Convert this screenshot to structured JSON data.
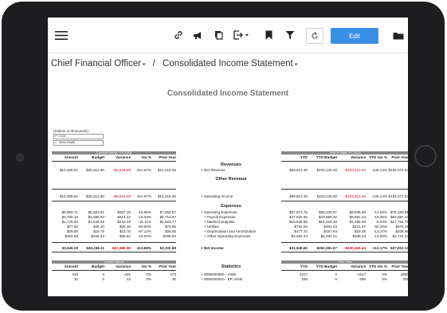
{
  "toolbar": {
    "edit_label": "Edit"
  },
  "breadcrumb": {
    "parent": "Chief Financial Officer",
    "separator": "/",
    "current": "Consolidated Income Statement"
  },
  "report": {
    "title": "Consolidated Income Statement"
  },
  "params": {
    "label": "(Dollars in thousands)",
    "fiscal_year": "FY 2018",
    "facility": "1 - Metro Health"
  },
  "left_header": "Current Period : FY 2018",
  "right_header": "Year to Date: FY 2018",
  "left_cols": [
    "Amount",
    "Budget",
    "Variance",
    "Var %",
    "Prior Year"
  ],
  "right_cols": [
    "YTD",
    "YTD Budget",
    "Variance",
    "YTD Var %",
    "Prior Year"
  ],
  "sections": {
    "revenues": "Revenues",
    "other_revenue": "Other Revenue",
    "expenses": "Expenses",
    "statistics": "Statistics"
  },
  "left_rows": [
    [
      "$10,495.91",
      "$20,312.50",
      "-$9,816.59",
      "-151.67%",
      "$10,215.46"
    ],
    [
      "$10,495.91",
      "$20,312.50",
      "-$9,816.59",
      "-151.67%",
      "$10,215.46"
    ],
    [
      "$6,850.71",
      "$5,923.61",
      "$927.10",
      "-15.65%",
      "$7,862.57"
    ],
    [
      "$4,700.16",
      "$4,085.94",
      "$614.22",
      "-15.03%",
      "$5,710.97"
    ],
    [
      "$1,778.82",
      "$1,545.35",
      "$233.48",
      "-15.11%",
      "$1,803.77"
    ],
    [
      "$77.20",
      "$48.10",
      "$29.10",
      "-60.50%",
      "$74.65"
    ],
    [
      "$29.55",
      "$15.79",
      "$13.76",
      "-87.12%",
      "$26.05"
    ],
    [
      "$264.96",
      "$228.42",
      "$36.54",
      "-16.00%",
      "$266.92"
    ],
    [
      "$3,645.20",
      "$26,236.11",
      "-$22,590.90",
      "-113.89%",
      "$2,332.89"
    ]
  ],
  "middle_labels": [
    "+ Net Revenue",
    "+ Operating Income",
    "+ Operating Expenses",
    "+ Payroll Expenses",
    "+ Medical Supplies",
    "+ Utilities",
    "+ Depreciation and Amortization",
    "+ Other Operating Expenses",
    "+ Net Income"
  ],
  "right_rows": [
    [
      "$99,812.38",
      "$203,125.00",
      "-$103,312.62",
      "-149.14%",
      "$104,072.94"
    ],
    [
      "$99,812.38",
      "$203,125.00",
      "-$103,312.62",
      "-149.14%",
      "$104,072.94"
    ],
    [
      "$67,871.76",
      "$59,236.07",
      "$8,635.69",
      "-14.58%",
      "$76,160.81"
    ],
    [
      "$47,540.65",
      "$40,859.42",
      "$6,681.23",
      "-16.35%",
      "$54,597.23"
    ],
    [
      "$16,848.86",
      "$15,453.48",
      "$1,395.39",
      "-9.03%",
      "$17,754.79"
    ],
    [
      "$722.50",
      "$481.03",
      "$241.47",
      "-50.20%",
      "$678.38"
    ],
    [
      "$177.31",
      "$157.93",
      "$19.38",
      "-12.27%",
      "$208.98"
    ],
    [
      "$2,582.44",
      "$2,294.21",
      "$288.23",
      "-13.06%",
      "$2,721.43"
    ],
    [
      "$31,940.62",
      "$262,361.07",
      "-$230,420.44",
      "-112.17%",
      "$27,912.13"
    ]
  ],
  "left_stat_header": "Current Month",
  "right_stat_header": "Prior Year",
  "left_stat_cols": [
    "Amount",
    "Budget",
    "Variance",
    "Var %",
    "Prior Year"
  ],
  "right_stat_cols": [
    "YTD",
    "YTD Budget",
    "Variance",
    "YTD Var %",
    "Prior Year"
  ],
  "stat_labels": [
    "+ 0090400000 - Visits",
    "+ 0090400010 - ER Visits"
  ],
  "left_stat_rows": [
    [
      "425",
      "0",
      "-425",
      "0%",
      "476"
    ],
    [
      "32",
      "0",
      "-32",
      "0%",
      "30"
    ]
  ],
  "right_stat_rows": [
    [
      "4317",
      "0",
      "-4317",
      "0%",
      "4680"
    ],
    [
      "256",
      "0",
      "-256",
      "0%",
      "258"
    ]
  ],
  "icons": [
    "menu-icon",
    "link-icon",
    "announce-icon",
    "copy-icon",
    "export-icon",
    "bookmark-icon",
    "filter-icon",
    "refresh-icon",
    "folder-icon"
  ]
}
